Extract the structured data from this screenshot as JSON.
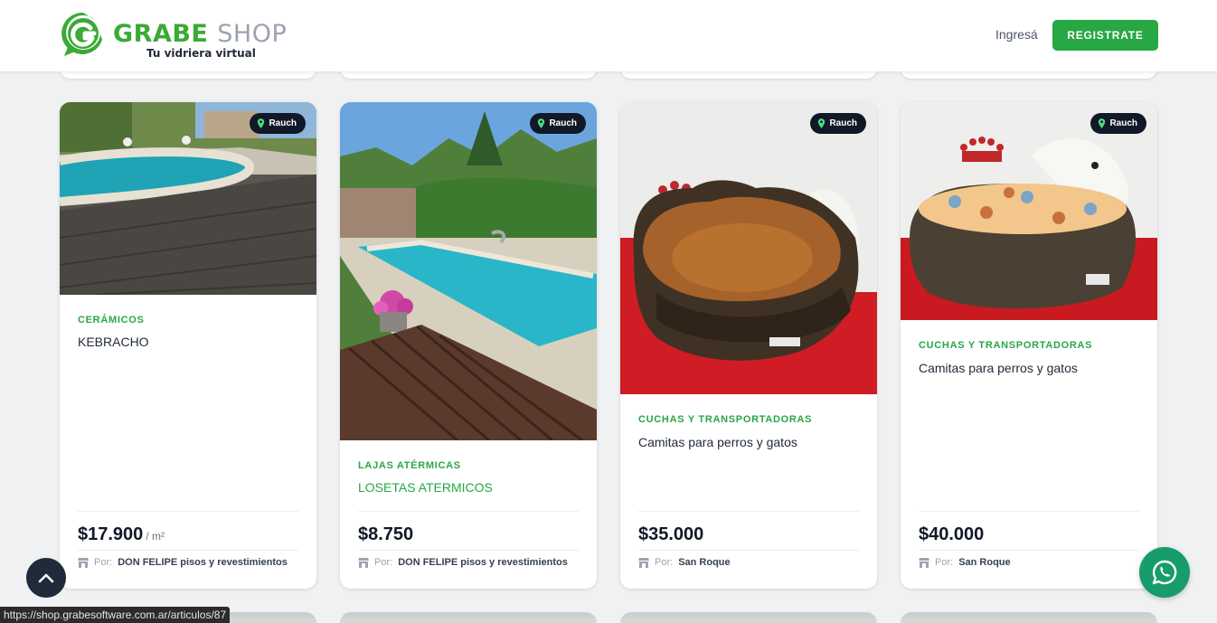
{
  "header": {
    "logo_word_green": "GRABE",
    "logo_word_gray": "SHOP",
    "logo_tagline": "Tu vidriera virtual",
    "login_label": "Ingresá",
    "register_label": "REGISTRATE"
  },
  "products": [
    {
      "location": "Rauch",
      "category": "CERÁMICOS",
      "title": "KEBRACHO",
      "price": "$17.900",
      "unit": "/ m²",
      "seller_prefix": "Por:",
      "seller": "DON FELIPE pisos y revestimientos"
    },
    {
      "location": "Rauch",
      "category": "LAJAS ATÉRMICAS",
      "title": "LOSETAS ATERMICOS",
      "price": "$8.750",
      "unit": "",
      "seller_prefix": "Por:",
      "seller": "DON FELIPE pisos y revestimientos"
    },
    {
      "location": "Rauch",
      "category": "CUCHAS Y TRANSPORTADORAS",
      "title": "Camitas para perros y gatos",
      "price": "$35.000",
      "unit": "",
      "seller_prefix": "Por:",
      "seller": "San Roque"
    },
    {
      "location": "Rauch",
      "category": "CUCHAS Y TRANSPORTADORAS",
      "title": "Camitas para perros y gatos",
      "price": "$40.000",
      "unit": "",
      "seller_prefix": "Por:",
      "seller": "San Roque"
    }
  ],
  "icons": {
    "location": "map-pin-icon",
    "store": "store-icon",
    "scroll_top": "chevron-up-icon",
    "whatsapp": "whatsapp-icon"
  },
  "colors": {
    "brand_green": "#28a745",
    "badge_dark": "#111827",
    "whatsapp": "#179c6b"
  },
  "status_bar": {
    "url": "https://shop.grabesoftware.com.ar/articulos/87"
  }
}
